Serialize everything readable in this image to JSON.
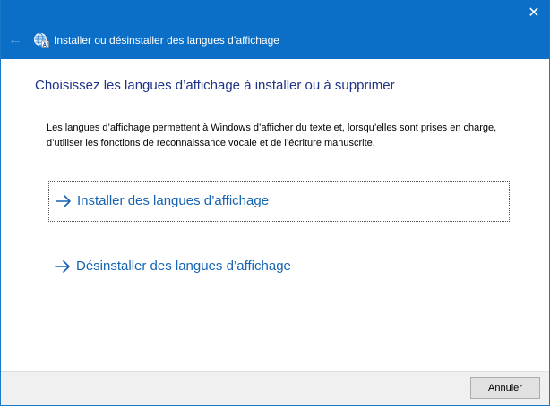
{
  "window": {
    "title": "Installer ou désinstaller des langues d’affichage",
    "close_glyph": "✕",
    "back_glyph": "←",
    "app_icon": "globe-language-icon",
    "titlebar_color": "#0b6fc8"
  },
  "main": {
    "heading": "Choisissez les langues d’affichage à installer ou à supprimer",
    "description": "Les langues d’affichage permettent à Windows d’afficher du texte et, lorsqu’elles sont prises en charge, d’utiliser les fonctions de reconnaissance vocale et de l’écriture manuscrite.",
    "options": [
      {
        "label": "Installer des langues d’affichage",
        "icon": "arrow-right-icon",
        "focused": true
      },
      {
        "label": "Désinstaller des langues d’affichage",
        "icon": "arrow-right-icon",
        "focused": false
      }
    ],
    "heading_color": "#1e3287",
    "link_color": "#1564b3"
  },
  "footer": {
    "cancel_label": "Annuler"
  }
}
